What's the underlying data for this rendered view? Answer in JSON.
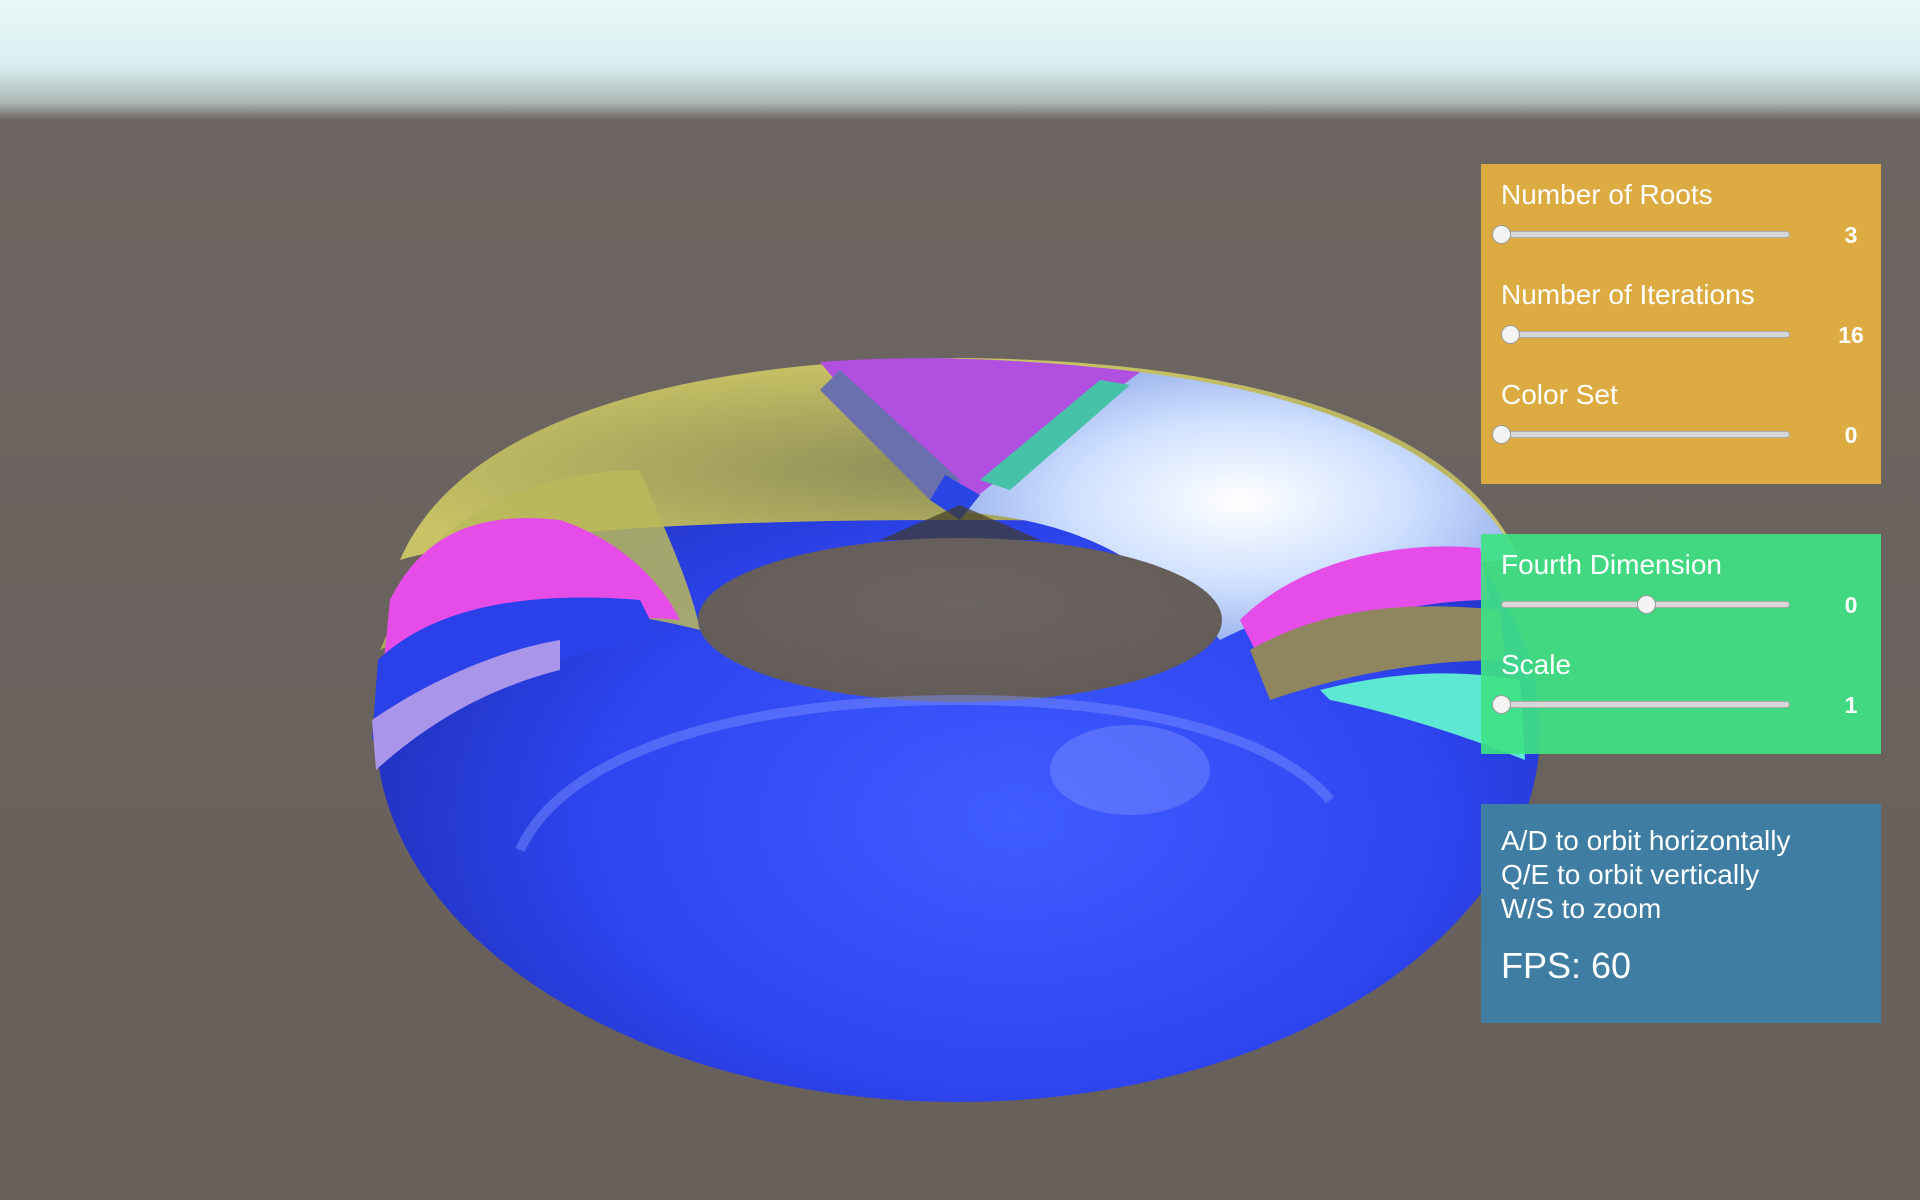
{
  "scene": {
    "subject": "torus",
    "description_colors": {
      "sky": "#e4f6f7",
      "ground": "#6b6460",
      "torus_main": "#2f46f5"
    }
  },
  "panels": {
    "fractal": {
      "color": "#dcab41",
      "controls": [
        {
          "label": "Number of Roots",
          "value": "3",
          "fraction": 0.0
        },
        {
          "label": "Number of Iterations",
          "value": "16",
          "fraction": 0.03
        },
        {
          "label": "Color Set",
          "value": "0",
          "fraction": 0.0
        }
      ]
    },
    "transform": {
      "color": "#3ee284",
      "controls": [
        {
          "label": "Fourth Dimension",
          "value": "0",
          "fraction": 0.5
        },
        {
          "label": "Scale",
          "value": "1",
          "fraction": 0.0
        }
      ]
    },
    "help": {
      "color": "#3f7da2",
      "lines": [
        "A/D to orbit horizontally",
        "Q/E to orbit vertically",
        "W/S to zoom"
      ],
      "fps": "FPS: 60"
    }
  }
}
